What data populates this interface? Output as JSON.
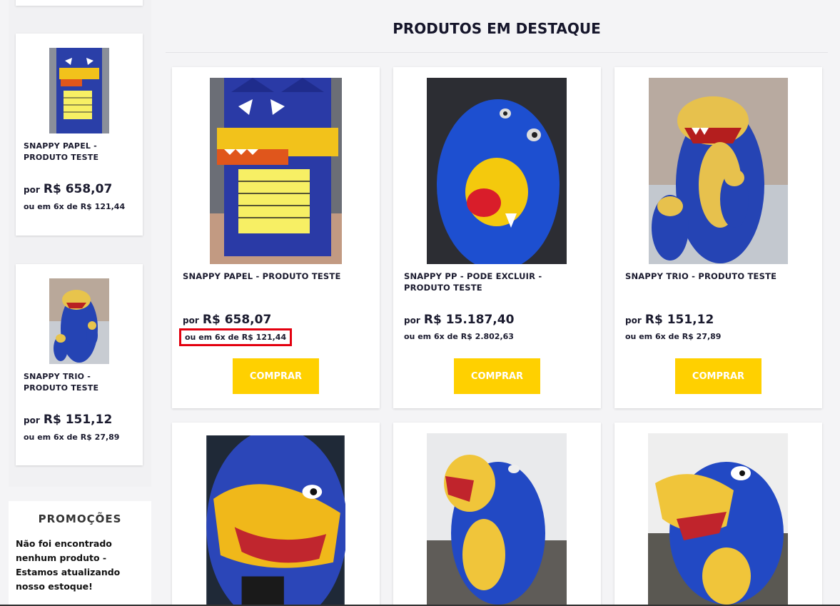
{
  "sidebar": {
    "items": [
      {
        "name": "SNAPPY PAPEL - PRODUTO TESTE",
        "por": "por",
        "price": "R$ 658,07",
        "installments": "ou em 6x de R$ 121,44"
      },
      {
        "name": "SNAPPY TRIO - PRODUTO TESTE",
        "por": "por",
        "price": "R$ 151,12",
        "installments": "ou em 6x de R$ 27,89"
      }
    ],
    "promo": {
      "title": "PROMOÇÕES",
      "text": "Não foi encontrado nenhum produto - Estamos atualizando nosso estoque!"
    }
  },
  "main": {
    "title": "PRODUTOS EM DESTAQUE",
    "products": [
      {
        "name": "SNAPPY PAPEL - PRODUTO TESTE",
        "por": "por",
        "price": "R$ 658,07",
        "installments": "ou em 6x de R$ 121,44",
        "buy_label": "COMPRAR"
      },
      {
        "name": "SNAPPY PP - PODE EXCLUIR - PRODUTO TESTE",
        "por": "por",
        "price": "R$ 15.187,40",
        "installments": "ou em 6x de R$ 2.802,63",
        "buy_label": "COMPRAR"
      },
      {
        "name": "SNAPPY TRIO - PRODUTO TESTE",
        "por": "por",
        "price": "R$ 151,12",
        "installments": "ou em 6x de R$ 27,89",
        "buy_label": "COMPRAR"
      }
    ]
  },
  "colors": {
    "accent": "#ffd000",
    "highlight": "#e3000f",
    "mascot_blue": "#1f3fb4",
    "mascot_yellow": "#f2c21b"
  }
}
